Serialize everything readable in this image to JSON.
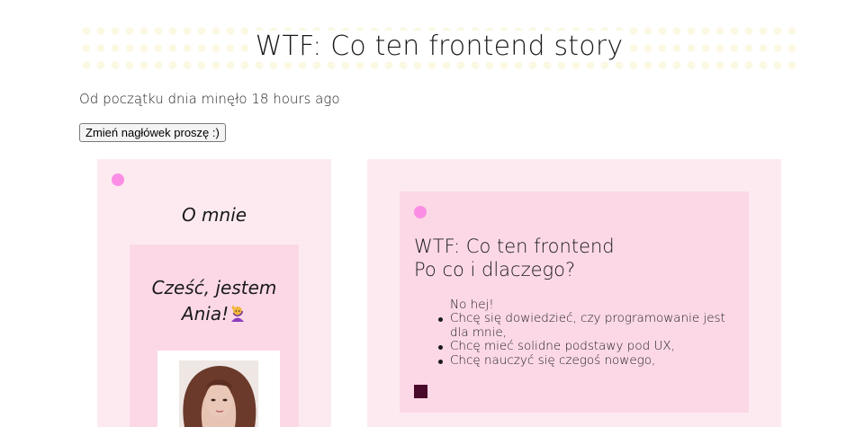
{
  "header": {
    "title": "WTF: Co ten frontend story"
  },
  "timer": {
    "text": "Od początku dnia minęło 18 hours ago"
  },
  "change_button": {
    "label": "Zmień nagłówek proszę :)"
  },
  "about": {
    "title": "O mnie",
    "greeting_line1": "Cześć, jestem",
    "greeting_line2": "Ania!",
    "greeting_emoji": "woman-raising-hand-icon"
  },
  "post": {
    "title_line1": "WTF: Co ten frontend",
    "title_line2": "Po co i dlaczego?",
    "intro": "No hej!",
    "items": [
      "Chcę się dowiedzieć, czy programowanie jest dla mnie,",
      "Chcę mieć solidne podstawy pod UX,",
      "Chcę nauczyć się czegoś nowego,"
    ]
  },
  "colors": {
    "panel_bg": "#fdeaf1",
    "card_bg": "#fcd8e6",
    "dot": "#fb8ee4",
    "square": "#4a0a2b",
    "header_pattern": "#fbf8e3"
  }
}
